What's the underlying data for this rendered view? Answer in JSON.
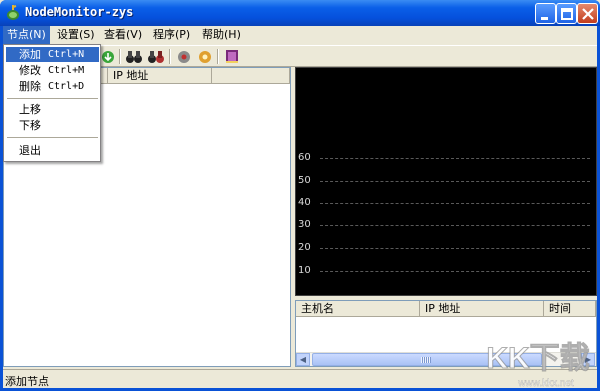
{
  "window": {
    "title": "NodeMonitor-zys"
  },
  "menubar": {
    "items": [
      "节点(N)",
      "设置(S)",
      "查看(V)",
      "程序(P)",
      "帮助(H)"
    ]
  },
  "dropdown": {
    "items": [
      {
        "label": "添加",
        "shortcut": "Ctrl+N"
      },
      {
        "label": "修改",
        "shortcut": "Ctrl+M"
      },
      {
        "label": "删除",
        "shortcut": "Ctrl+D"
      },
      {
        "label": "上移",
        "shortcut": ""
      },
      {
        "label": "下移",
        "shortcut": ""
      },
      {
        "label": "退出",
        "shortcut": ""
      }
    ]
  },
  "left_list": {
    "columns": [
      "",
      "IP 地址",
      ""
    ]
  },
  "graph": {
    "y_ticks": [
      "60",
      "50",
      "40",
      "30",
      "20",
      "10"
    ]
  },
  "right_list": {
    "columns": [
      "主机名",
      "IP 地址",
      "时间"
    ]
  },
  "statusbar": {
    "text": "添加节点"
  },
  "watermark": {
    "brand": "KK下载",
    "url": "www.kkx.net"
  }
}
